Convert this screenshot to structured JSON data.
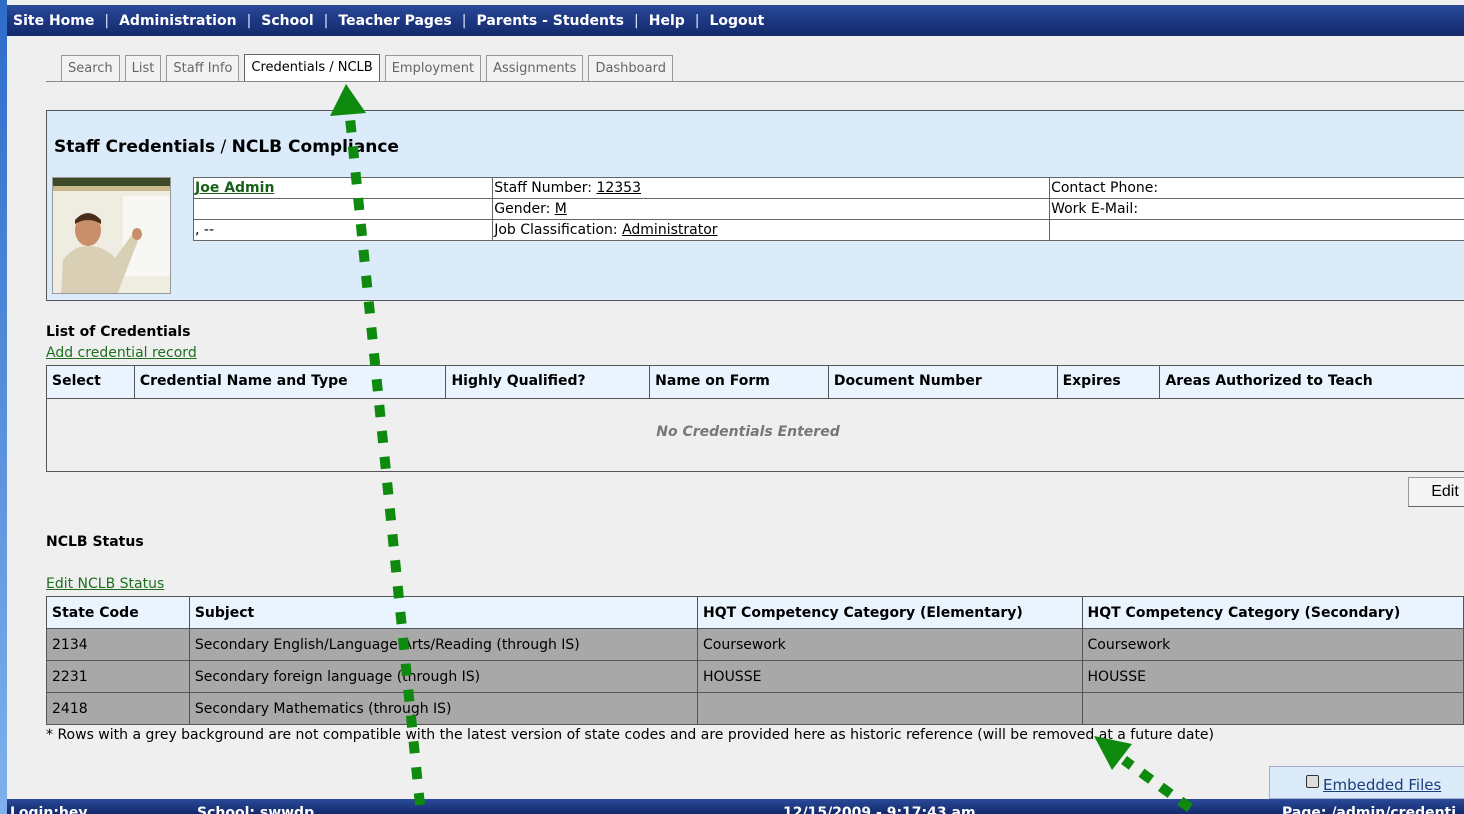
{
  "topnav": {
    "items": [
      "Site Home",
      "Administration",
      "School",
      "Teacher Pages",
      "Parents - Students",
      "Help",
      "Logout"
    ],
    "separator": "|"
  },
  "tabs": [
    "Search",
    "List",
    "Staff Info",
    "Credentials / NCLB",
    "Employment",
    "Assignments",
    "Dashboard"
  ],
  "active_tab": "Credentials / NCLB",
  "header": {
    "title_part1": "Staff Credentials",
    "title_slash": " / ",
    "title_part2": "NCLB Compliance",
    "name": "Joe Admin",
    "name_line3": ", --",
    "staff_number_label": "Staff Number: ",
    "staff_number": "12353",
    "gender_label": "Gender: ",
    "gender": "M",
    "job_label": "Job Classification: ",
    "job": "Administrator",
    "contact_phone_label": "Contact Phone:",
    "work_email_label": "Work E-Mail:"
  },
  "credentials": {
    "title": "List of Credentials",
    "add_link": "Add credential record",
    "columns": [
      "Select",
      "Credential Name and Type",
      "Highly Qualified?",
      "Name on Form",
      "Document Number",
      "Expires",
      "Areas Authorized to Teach"
    ],
    "empty_text": "No Credentials Entered"
  },
  "edit_button": "Edit",
  "nclb": {
    "title": "NCLB Status",
    "edit_link": "Edit NCLB Status",
    "columns": [
      "State Code",
      "Subject",
      "HQT Competency Category (Elementary)",
      "HQT Competency Category (Secondary)"
    ],
    "rows": [
      [
        "2134",
        "Secondary English/Language Arts/Reading (through IS)",
        "Coursework",
        "Coursework"
      ],
      [
        "2231",
        "Secondary foreign language (through IS)",
        "HOUSSE",
        "HOUSSE"
      ],
      [
        "2418",
        "Secondary Mathematics (through IS)",
        "",
        ""
      ]
    ],
    "footnote": "* Rows with a grey background are not compatible with the latest version of state codes and are provided here as historic reference (will be removed at a future date)"
  },
  "embedded_files": "Embedded Files",
  "statusbar": {
    "login": "Login:hey",
    "school": "School: swwdp",
    "datetime": "12/15/2009 - 9:17:43 am",
    "page": "Page: /admin/credenti"
  },
  "colors": {
    "nav_bg": "#1c3680",
    "header_bg": "#dcebfa",
    "grey_row": "#a8a8a8",
    "link_green": "#1f6f1f",
    "annotation_arrow": "#0e8a0e"
  }
}
